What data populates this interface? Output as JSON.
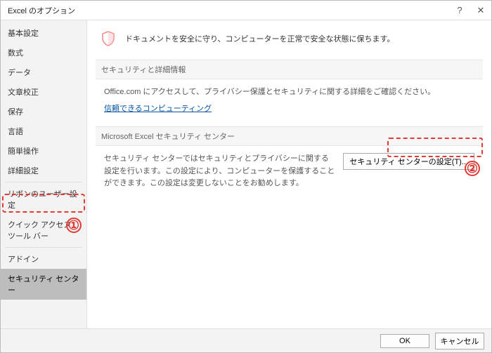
{
  "title": "Excel のオプション",
  "titlebar_help": "?",
  "titlebar_close": "✕",
  "sidebar": {
    "items": [
      {
        "label": "基本設定"
      },
      {
        "label": "数式"
      },
      {
        "label": "データ"
      },
      {
        "label": "文章校正"
      },
      {
        "label": "保存"
      },
      {
        "label": "言語"
      },
      {
        "label": "簡単操作"
      },
      {
        "label": "詳細設定"
      }
    ],
    "items2": [
      {
        "label": "リボンのユーザー設定"
      },
      {
        "label": "クイック アクセス ツール バー"
      }
    ],
    "items3": [
      {
        "label": "アドイン"
      },
      {
        "label": "セキュリティ センター"
      }
    ]
  },
  "intro": "ドキュメントを安全に守り、コンピューターを正常で安全な状態に保ちます。",
  "section1": {
    "header": "セキュリティと詳細情報",
    "text": "Office.com にアクセスして、プライバシー保護とセキュリティに関する詳細をご確認ください。",
    "link": "信頼できるコンピューティング"
  },
  "section2": {
    "header": "Microsoft Excel セキュリティ センター",
    "text": "セキュリティ センターではセキュリティとプライバシーに関する設定を行います。この設定により、コンピューターを保護することができます。この設定は変更しないことをお勧めします。",
    "button": "セキュリティ センターの設定(T)..."
  },
  "footer": {
    "ok": "OK",
    "cancel": "キャンセル"
  },
  "callouts": {
    "one": "①",
    "two": "②"
  }
}
